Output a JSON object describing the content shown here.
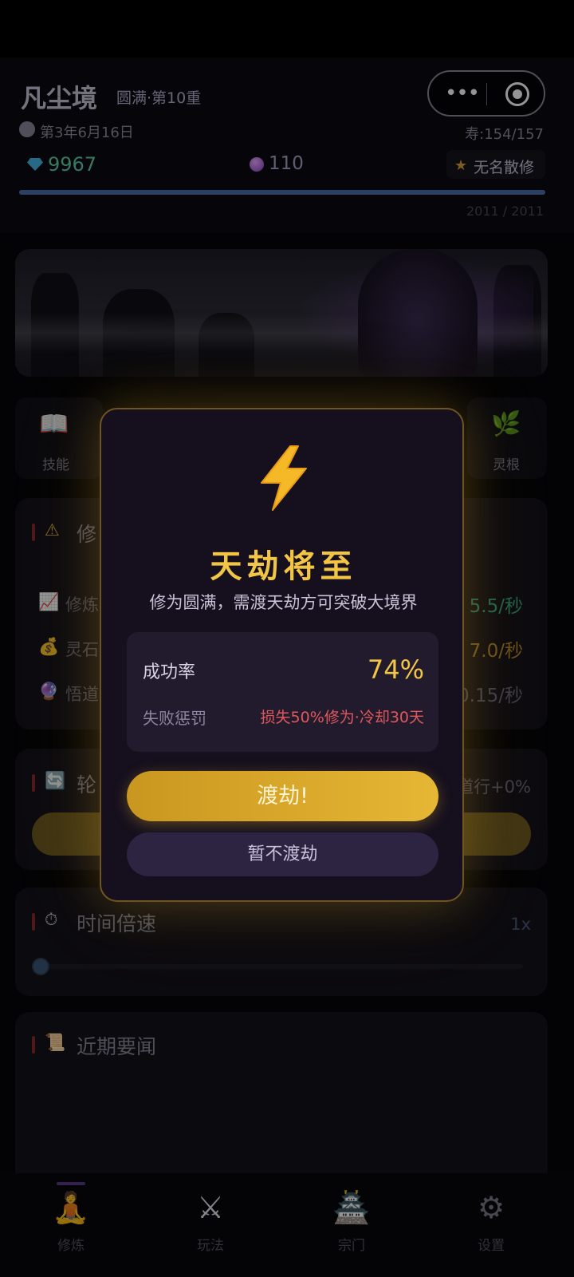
{
  "header": {
    "realm_name": "凡尘境",
    "realm_stage": "圆满·第10重",
    "date": "第3年6月16日",
    "lifespan": "寿:154/157",
    "spirit_stones": "9967",
    "insight_orbs": "110",
    "title": "无名散修",
    "progress_text": "2011 / 2011",
    "progress_fraction": 1.0
  },
  "quick_actions": {
    "skills_label": "技能",
    "root_label": "灵根"
  },
  "cultivation_card": {
    "title": "修",
    "rows": [
      {
        "label": "修炼",
        "icon": "chart-up-icon",
        "value": "5.5/秒",
        "color": "#3aa87e"
      },
      {
        "label": "灵石",
        "icon": "money-bag-icon",
        "value": "7.0/秒",
        "color": "#b98a2a"
      },
      {
        "label": "悟道",
        "icon": "crystal-ball-icon",
        "value": "0.15/秒",
        "color": "#6a6780"
      }
    ]
  },
  "cycle_card": {
    "title": "轮",
    "bonus": "道行+0%"
  },
  "speed_card": {
    "title": "时间倍速",
    "value": "1x",
    "level_fraction": 0
  },
  "news_card": {
    "title": "近期要闻"
  },
  "tabs": [
    {
      "label": "修炼",
      "icon": "meditation-icon"
    },
    {
      "label": "玩法",
      "icon": "crossed-swords-icon"
    },
    {
      "label": "宗门",
      "icon": "temple-icon"
    },
    {
      "label": "设置",
      "icon": "gear-icon"
    }
  ],
  "modal": {
    "icon": "lightning-icon",
    "title": "天劫将至",
    "description": "修为圆满，需渡天劫方可突破大境界",
    "success_label": "成功率",
    "success_value": "74%",
    "penalty_label": "失败惩罚",
    "penalty_value": "损失50%修为·冷却30天",
    "confirm_label": "渡劫!",
    "cancel_label": "暂不渡劫"
  },
  "colors": {
    "accent_gold": "#f2c644",
    "danger_red": "#e0585a",
    "modal_bg": "#150f1e"
  }
}
